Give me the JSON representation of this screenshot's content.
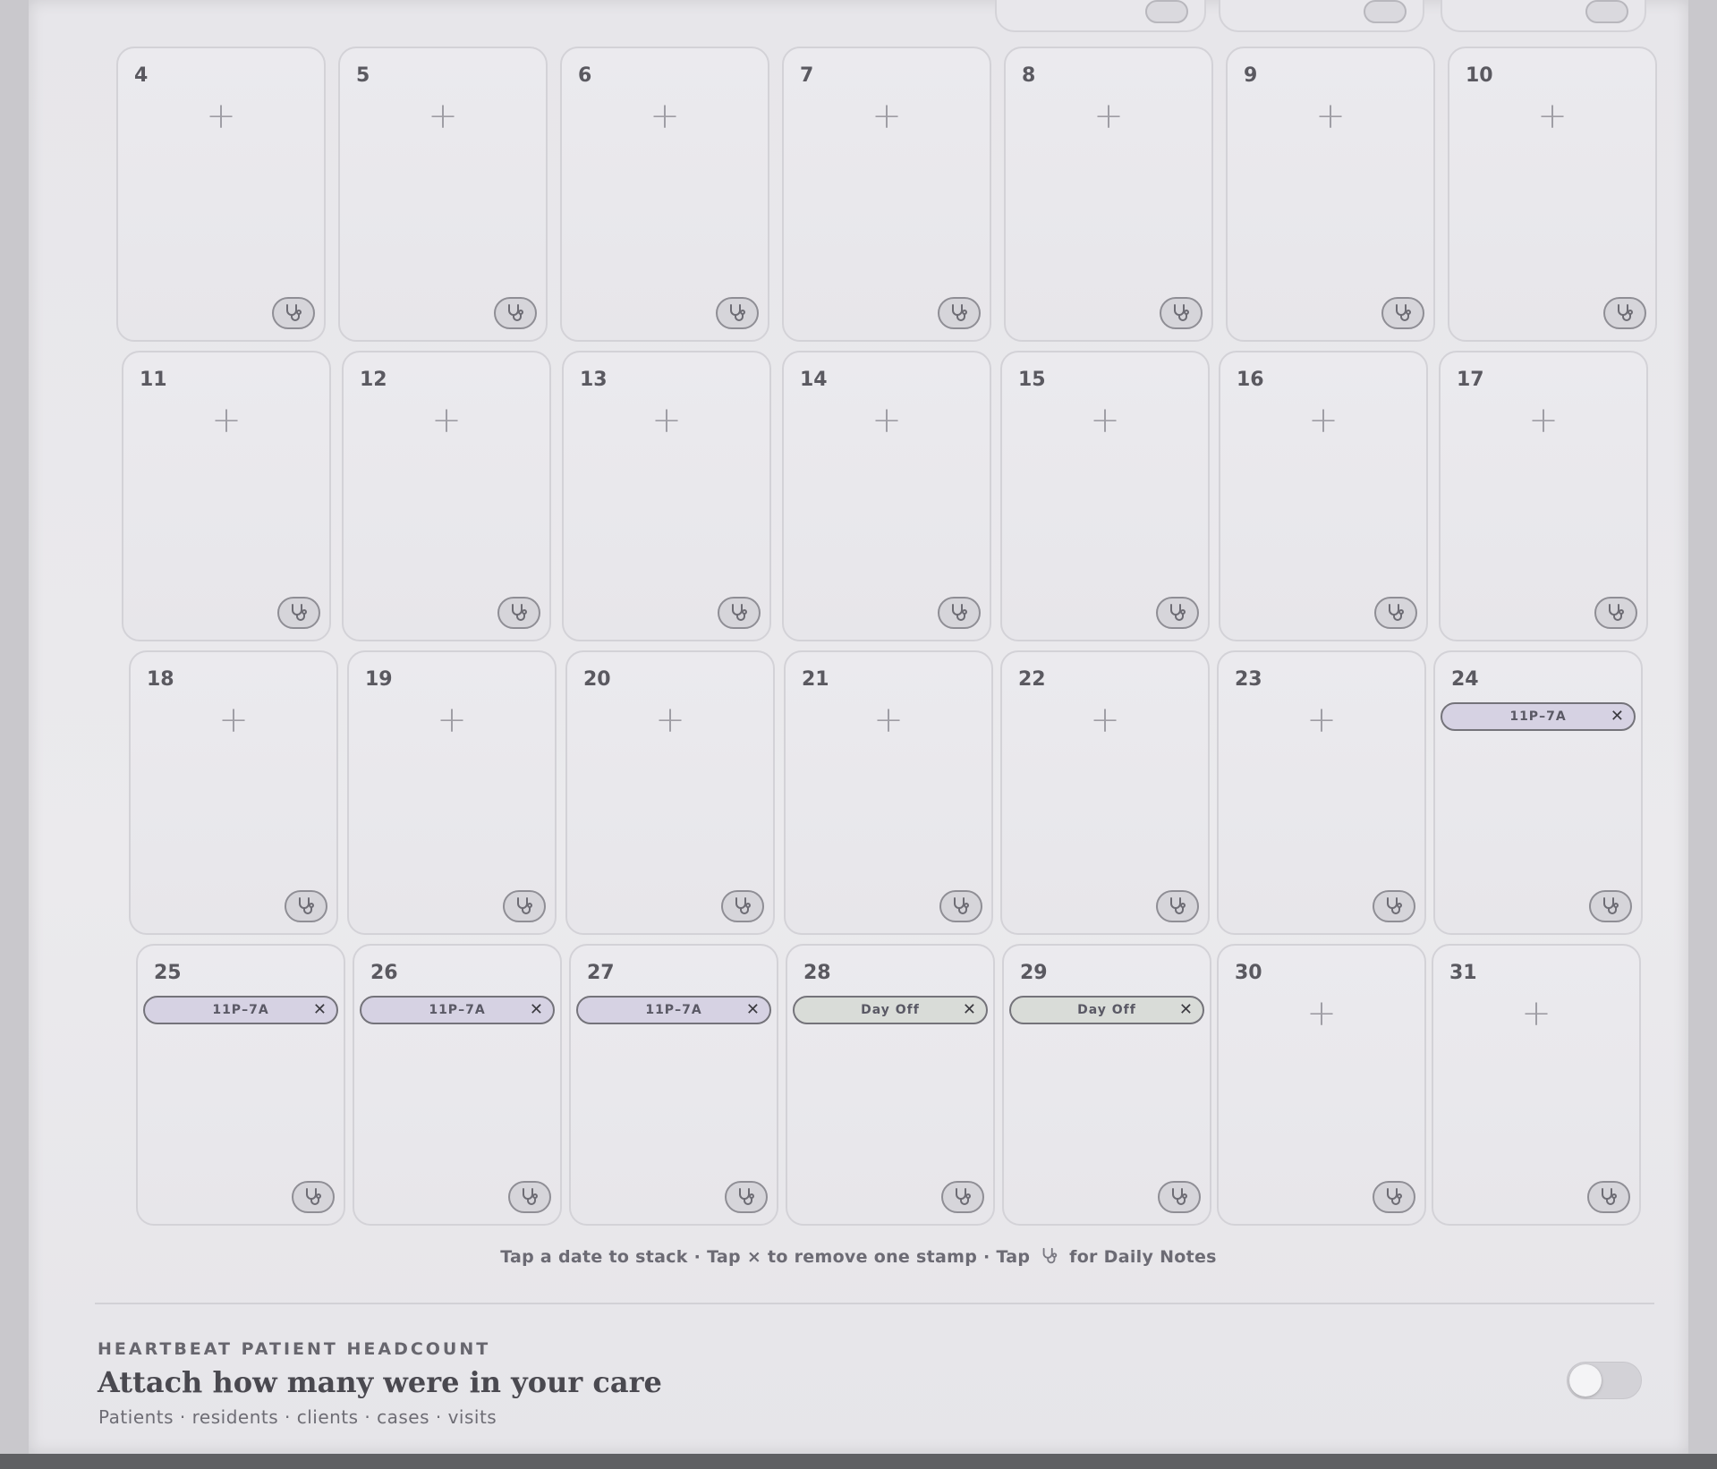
{
  "calendar": {
    "rows": [
      [
        {
          "day": "4",
          "stamps": []
        },
        {
          "day": "5",
          "stamps": []
        },
        {
          "day": "6",
          "stamps": []
        },
        {
          "day": "7",
          "stamps": []
        },
        {
          "day": "8",
          "stamps": []
        },
        {
          "day": "9",
          "stamps": []
        },
        {
          "day": "10",
          "stamps": []
        }
      ],
      [
        {
          "day": "11",
          "stamps": []
        },
        {
          "day": "12",
          "stamps": []
        },
        {
          "day": "13",
          "stamps": []
        },
        {
          "day": "14",
          "stamps": []
        },
        {
          "day": "15",
          "stamps": []
        },
        {
          "day": "16",
          "stamps": []
        },
        {
          "day": "17",
          "stamps": []
        }
      ],
      [
        {
          "day": "18",
          "stamps": []
        },
        {
          "day": "19",
          "stamps": []
        },
        {
          "day": "20",
          "stamps": []
        },
        {
          "day": "21",
          "stamps": []
        },
        {
          "day": "22",
          "stamps": []
        },
        {
          "day": "23",
          "stamps": []
        },
        {
          "day": "24",
          "stamps": [
            {
              "label": "11P–7A",
              "kind": "shift"
            }
          ]
        }
      ],
      [
        {
          "day": "25",
          "stamps": [
            {
              "label": "11P–7A",
              "kind": "shift"
            }
          ]
        },
        {
          "day": "26",
          "stamps": [
            {
              "label": "11P–7A",
              "kind": "shift"
            }
          ]
        },
        {
          "day": "27",
          "stamps": [
            {
              "label": "11P–7A",
              "kind": "shift"
            }
          ]
        },
        {
          "day": "28",
          "stamps": [
            {
              "label": "Day Off",
              "kind": "off"
            }
          ]
        },
        {
          "day": "29",
          "stamps": [
            {
              "label": "Day Off",
              "kind": "off"
            }
          ]
        },
        {
          "day": "30",
          "stamps": []
        },
        {
          "day": "31",
          "stamps": []
        }
      ]
    ],
    "add_glyph": "+",
    "remove_glyph": "✕",
    "notes_icon": "stethoscope-icon"
  },
  "hint": {
    "part1": "Tap a date to stack · Tap × to remove one stamp · Tap",
    "part2": "for Daily Notes"
  },
  "headcount": {
    "eyebrow": "HEARTBEAT PATIENT HEADCOUNT",
    "title": "Attach how many were in your care",
    "subtitle": "Patients · residents · clients · cases · visits",
    "toggle_on": false
  },
  "colors": {
    "shift_stamp_bg": "#d6d2e3",
    "dayoff_stamp_bg": "#d9dcd8",
    "cell_border": "#d3d2d7"
  }
}
